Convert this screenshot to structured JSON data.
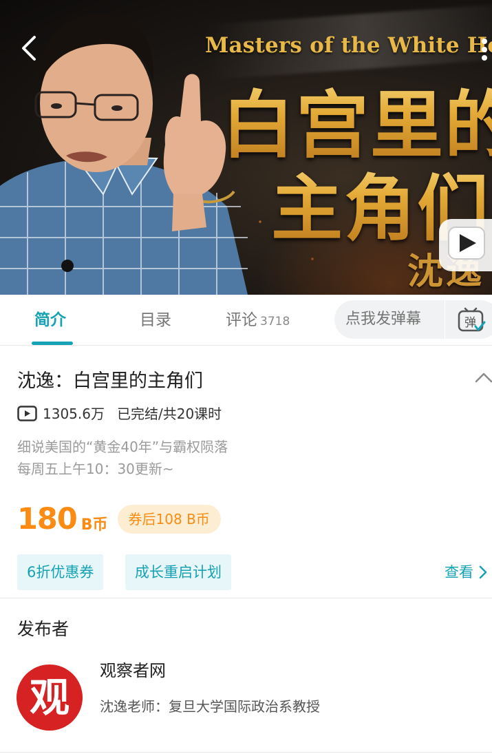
{
  "video": {
    "cover_subtitle_en": "Masters of the White House",
    "cover_title_line1": "白宫里的",
    "cover_title_line2": "主角们",
    "cover_author": "沈逸"
  },
  "tabs": [
    {
      "label": "简介",
      "active": true
    },
    {
      "label": "目录"
    },
    {
      "label": "评论",
      "count": "3718"
    }
  ],
  "danmaku": {
    "placeholder": "点我发弹幕",
    "icon_text": "弹"
  },
  "course": {
    "title": "沈逸：白宫里的主角们",
    "views": "1305.6万",
    "status": "已完结/共20课时",
    "description_line1": "细说美国的“黄金40年”与霸权陨落",
    "description_line2": "每周五上午10：30更新~",
    "price": "180",
    "price_unit": "B币",
    "coupon_price": "券后108 B币",
    "tags": [
      "6折优惠券",
      "成长重启计划"
    ],
    "view_more": "查看"
  },
  "publisher": {
    "heading": "发布者",
    "logo_glyph": "观",
    "name": "观察者网",
    "description": "沈逸老师：复旦大学国际政治系教授"
  },
  "colors": {
    "accent": "#14a2b4",
    "price": "#fb8b12",
    "coupon_bg": "#fdeed3",
    "tag_bg": "#e7f6f8",
    "logo_red": "#d62222",
    "cover_gold": "#e8b948"
  },
  "icons": [
    "back-arrow-icon",
    "more-vertical-icon",
    "tv-play-icon",
    "danmaku-icon",
    "chevron-up-icon",
    "play-count-icon",
    "chevron-right-icon"
  ]
}
